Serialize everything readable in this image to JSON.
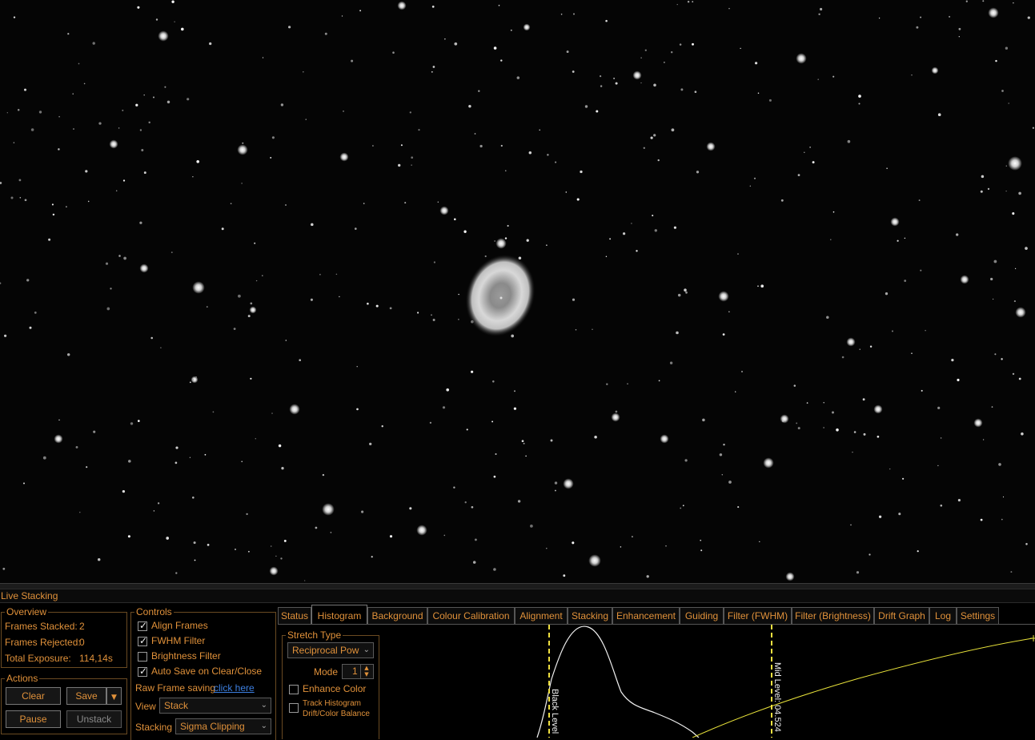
{
  "panel": {
    "title": "Live Stacking"
  },
  "overview": {
    "legend": "Overview",
    "frames_stacked_label": "Frames Stacked:",
    "frames_stacked_value": "2",
    "frames_rejected_label": "Frames Rejected:",
    "frames_rejected_value": "0",
    "total_exposure_label": "Total Exposure:",
    "total_exposure_value": "114,14s"
  },
  "actions": {
    "legend": "Actions",
    "clear": "Clear",
    "save": "Save",
    "pause": "Pause",
    "unstack": "Unstack"
  },
  "controls": {
    "legend": "Controls",
    "align_frames": "Align Frames",
    "fwhm_filter": "FWHM Filter",
    "brightness_filter": "Brightness Filter",
    "auto_save": "Auto Save on Clear/Close",
    "raw_frame_saving": "Raw Frame saving",
    "click_here": "click here",
    "view_label": "View",
    "view_value": "Stack",
    "stacking_label": "Stacking",
    "stacking_value": "Sigma Clipping"
  },
  "tabs": [
    "Status",
    "Histogram",
    "Background",
    "Colour Calibration",
    "Alignment",
    "Stacking",
    "Enhancement",
    "Guiding",
    "Filter (FWHM)",
    "Filter (Brightness)",
    "Drift Graph",
    "Log",
    "Settings"
  ],
  "histogram": {
    "stretch_legend": "Stretch Type",
    "stretch_value": "Reciprocal Pow",
    "mode_label": "Mode",
    "mode_value": "1",
    "enhance_color": "Enhance Color",
    "track_histogram_line1": "Track Histogram",
    "track_histogram_line2": "Drift/Color Balance",
    "black_level_label": "Black Level",
    "mid_level_label": "Mid Level: 04.524"
  },
  "colors": {
    "accent": "#e0913a",
    "link": "#3c7fe0",
    "curve": "#e8e23a",
    "marker": "#f0e040"
  }
}
